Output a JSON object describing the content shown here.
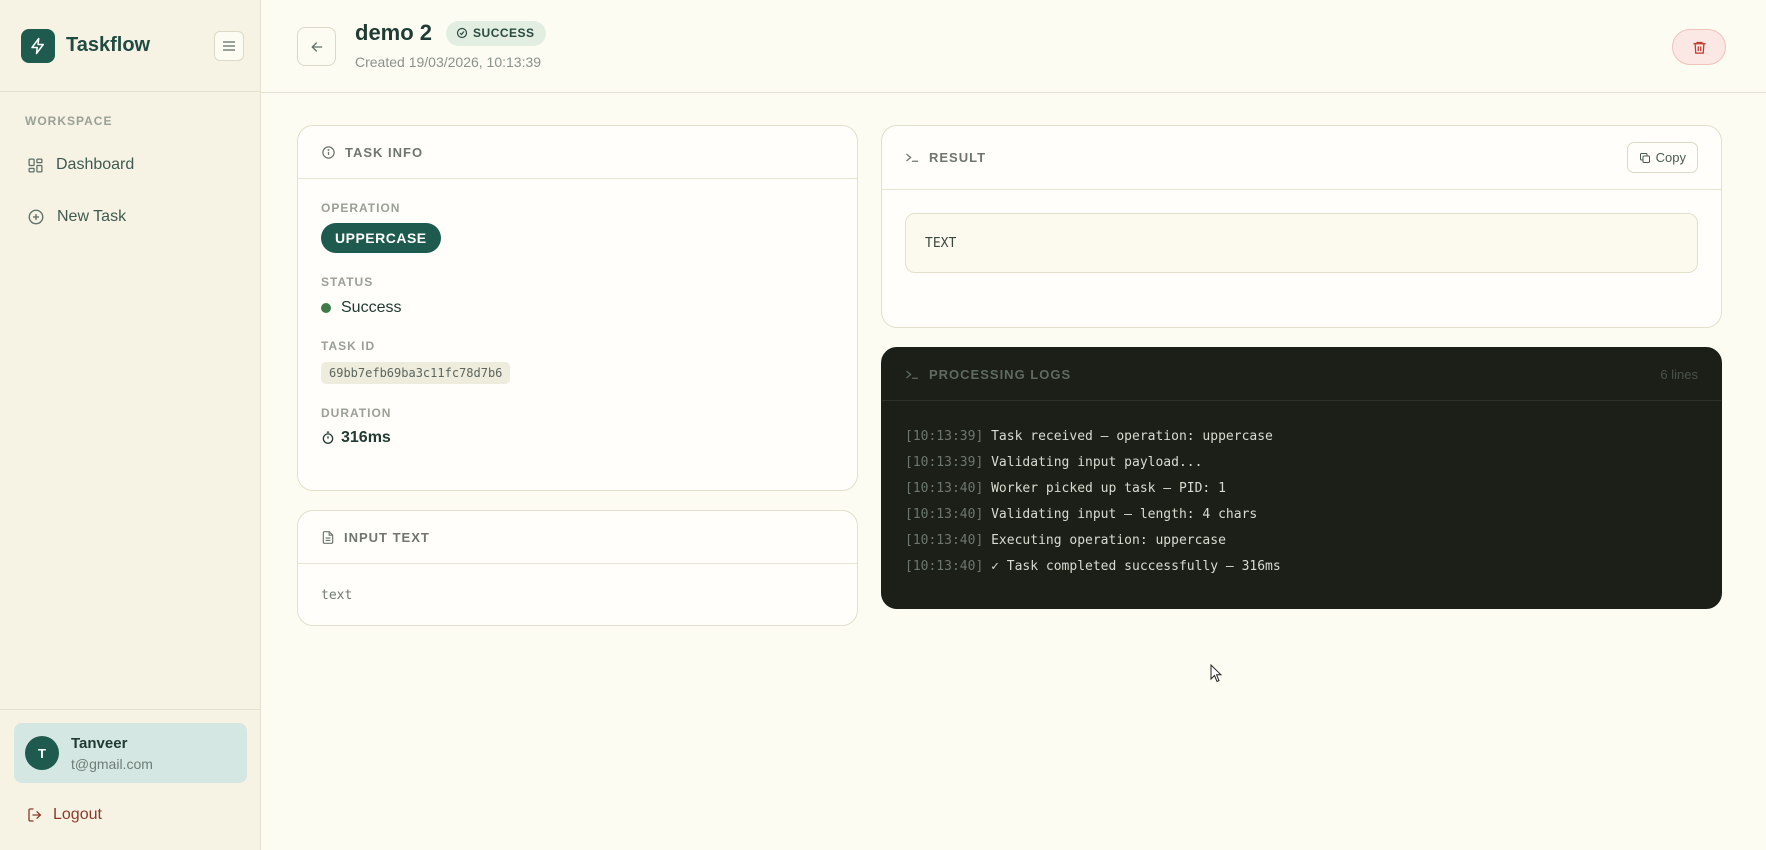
{
  "sidebar": {
    "brand": "Taskflow",
    "section": "WORKSPACE",
    "items": [
      {
        "label": "Dashboard",
        "icon": "grid-icon"
      },
      {
        "label": "New Task",
        "icon": "plus-circle-icon"
      }
    ],
    "user": {
      "initial": "T",
      "name": "Tanveer",
      "email": "t@gmail.com"
    },
    "logout": "Logout"
  },
  "header": {
    "title": "demo 2",
    "status": "SUCCESS",
    "created": "Created 19/03/2026, 10:13:39"
  },
  "task_info": {
    "title": "TASK INFO",
    "operation_label": "OPERATION",
    "operation": "UPPERCASE",
    "status_label": "STATUS",
    "status": "Success",
    "task_id_label": "TASK ID",
    "task_id": "69bb7efb69ba3c11fc78d7b6",
    "duration_label": "DURATION",
    "duration": "316ms"
  },
  "input_text": {
    "title": "INPUT TEXT",
    "value": "text"
  },
  "result": {
    "title": "RESULT",
    "copy_label": "Copy",
    "value": "TEXT"
  },
  "logs": {
    "title": "PROCESSING LOGS",
    "count": "6 lines",
    "lines": [
      {
        "time": "[10:13:39]",
        "msg": "Task received — operation: uppercase"
      },
      {
        "time": "[10:13:39]",
        "msg": "Validating input payload..."
      },
      {
        "time": "[10:13:40]",
        "msg": "Worker picked up task — PID: 1"
      },
      {
        "time": "[10:13:40]",
        "msg": "Validating input — length: 4 chars"
      },
      {
        "time": "[10:13:40]",
        "msg": "Executing operation: uppercase"
      },
      {
        "time": "[10:13:40]",
        "msg": "✓ Task completed successfully — 316ms"
      }
    ]
  },
  "colors": {
    "primary": "#1f5a4e",
    "background": "#fdfcf3",
    "sidebar": "#f6f3e4",
    "log_background": "#1b1f18",
    "danger": "#c0392b"
  }
}
